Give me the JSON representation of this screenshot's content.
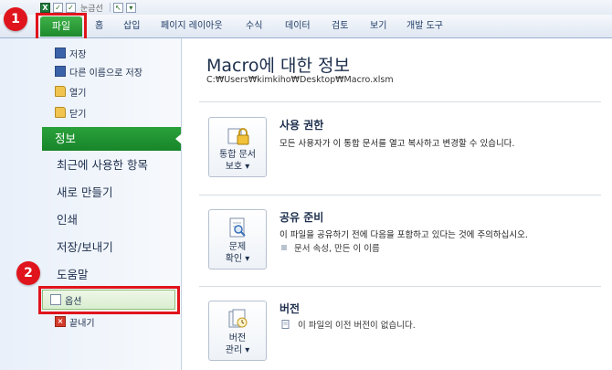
{
  "quick_access": {
    "gridlines_label": "눈금선"
  },
  "ribbon": {
    "file_tab": "파일",
    "tabs": [
      "홈",
      "삽입",
      "페이지 레이아웃",
      "수식",
      "데이터",
      "검토",
      "보기",
      "개발 도구"
    ]
  },
  "backstage": {
    "commands": {
      "save": "저장",
      "save_as": "다른 이름으로 저장",
      "open": "열기",
      "close": "닫기"
    },
    "nav": {
      "info": "정보",
      "recent": "최근에 사용한 항목",
      "new": "새로 만들기",
      "print": "인쇄",
      "save_send": "저장/보내기",
      "help": "도움말"
    },
    "options": "옵션",
    "exit": "끝내기"
  },
  "info": {
    "title": "Macro에 대한 정보",
    "path": "C:₩Users₩kimkiho₩Desktop₩Macro.xlsm",
    "permissions": {
      "button_line1": "통합 문서",
      "button_line2": "보호 ▾",
      "heading": "사용 권한",
      "description": "모든 사용자가 이 통합 문서를 열고 복사하고 변경할 수 있습니다."
    },
    "sharing": {
      "button_line1": "문제",
      "button_line2": "확인 ▾",
      "heading": "공유 준비",
      "description": "이 파일을 공유하기 전에 다음을 포함하고 있다는 것에 주의하십시오.",
      "bullet": "문서 속성, 만든 이 이름"
    },
    "versions": {
      "button_line1": "버전",
      "button_line2": "관리 ▾",
      "heading": "버전",
      "description": "이 파일의 이전 버전이 없습니다."
    }
  },
  "annotations": {
    "step1": "1",
    "step2": "2"
  },
  "colors": {
    "accent_green": "#1e8a2c",
    "highlight_red": "#e0141c"
  }
}
